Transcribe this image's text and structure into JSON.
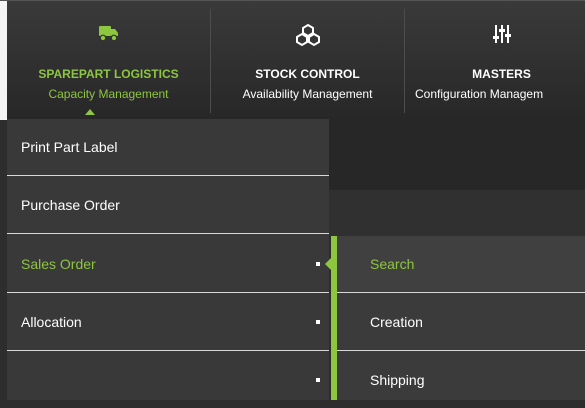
{
  "nav": {
    "items": [
      {
        "title": "SPAREPART LOGISTICS",
        "subtitle": "Capacity Management",
        "icon": "truck-icon"
      },
      {
        "title": "STOCK CONTROL",
        "subtitle": "Availability Management",
        "icon": "boxes-icon"
      },
      {
        "title": "MASTERS",
        "subtitle": "Configuration Managem",
        "icon": "sliders-icon"
      }
    ],
    "active_color": "#8dc63f"
  },
  "menu": {
    "items": [
      {
        "label": "Print Part Label"
      },
      {
        "label": "Purchase Order"
      },
      {
        "label": "Sales Order"
      },
      {
        "label": "Allocation"
      }
    ]
  },
  "submenu": {
    "items": [
      {
        "label": "Search"
      },
      {
        "label": "Creation"
      },
      {
        "label": "Shipping"
      }
    ]
  }
}
